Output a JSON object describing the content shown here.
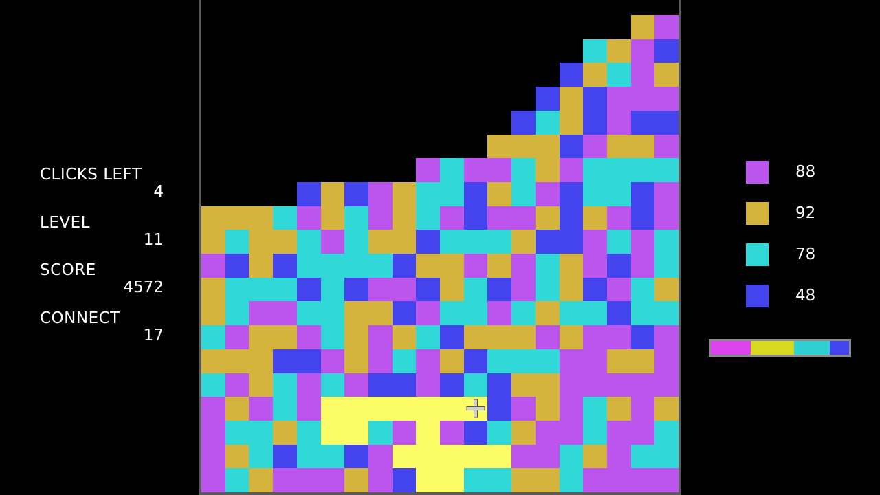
{
  "stats": {
    "clicks_left_label": "CLICKS LEFT",
    "clicks_left_value": "4",
    "level_label": "LEVEL",
    "level_value": "11",
    "score_label": "SCORE",
    "score_value": "4572",
    "connect_label": "CONNECT",
    "connect_value": "17"
  },
  "colors": {
    "M": "#bb55ee",
    "G": "#d4b43c",
    "C": "#30d8d8",
    "B": "#4444ee",
    "Y": "#fcfc66",
    ".": "#000000"
  },
  "board": {
    "columns": 20,
    "rows": 21,
    "grid": [
      "...................GM",
      "..................CGMB",
      "..................BGCMG",
      "..................BGBMMM",
      "..................BCGBMBB",
      "..................GGGBMGGM",
      "..................MCMMCGMCCCC",
      "..................BGBMGCCBGCMBCCBM",
      "..................GGGCMGCMGCMBMMGBGMBM",
      "..................GCGGCMCGGBCCCGBBMCMC",
      "..................MBGBCCCCBGGMGMCGMBMC",
      "..................GCCCBCBMMBGCBMCGBMCG",
      "..................GCMMCCGGBMCCMCGCCBCC",
      "..................CMGGMCGMGCBGGGMGMMBM",
      "..................GGGBBMGMCMGBCCCMMGGM",
      "..................CMGCMCMBBMBCBGGMMMMM",
      "..................MGMCMYYYYYYYBMGMCGMG",
      "..................MCCGCYYCMYMBCGMMCMMC",
      "..................MGCBCCBMYYYYYMMCGMCC",
      "..................MCGMMMGMBYYCCGGCMMMM"
    ],
    "rows_data": [
      "...................GM",
      "..................CGMB"
    ]
  },
  "legend": [
    {
      "color": "#bb55ee",
      "count": "88"
    },
    {
      "color": "#d4b43c",
      "count": "92"
    },
    {
      "color": "#30d8d8",
      "count": "78"
    },
    {
      "color": "#4444ee",
      "count": "48"
    }
  ],
  "progress": {
    "segments": [
      {
        "color": "#dd44ee",
        "fraction": 0.29
      },
      {
        "color": "#d8d820",
        "fraction": 0.31
      },
      {
        "color": "#30d0d0",
        "fraction": 0.26
      },
      {
        "color": "#4444ee",
        "fraction": 0.14
      }
    ]
  },
  "cursor_icon": "crosshair-cursor-icon"
}
